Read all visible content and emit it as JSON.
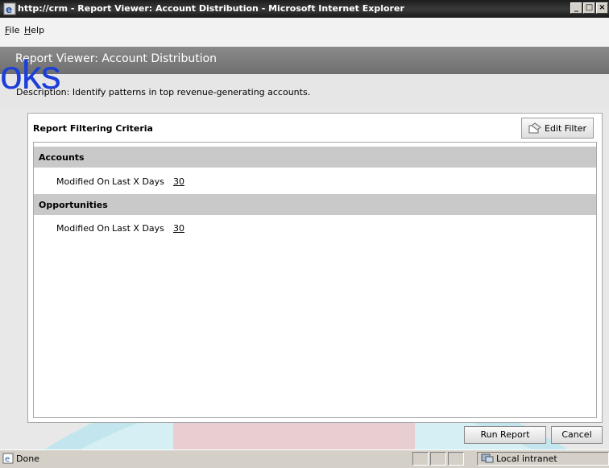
{
  "window": {
    "title": "http://crm - Report Viewer: Account Distribution - Microsoft Internet Explorer",
    "min_label": "_",
    "max_label": "□",
    "close_label": "×"
  },
  "menu": {
    "file_label": "File",
    "file_key": "F",
    "file_rest": "ile",
    "help_label": "Help",
    "help_key": "H",
    "help_rest": "elp"
  },
  "watermark_text": "oks",
  "header": {
    "title": "Report Viewer: Account Distribution",
    "description": "Description: Identify patterns in top revenue-generating accounts."
  },
  "panel": {
    "criteria_title": "Report Filtering Criteria",
    "edit_filter_label": "Edit Filter",
    "sections": [
      {
        "name": "Accounts",
        "rows": [
          {
            "field": "Modified On",
            "operator": "Last X Days",
            "value": "30"
          }
        ]
      },
      {
        "name": "Opportunities",
        "rows": [
          {
            "field": "Modified On",
            "operator": "Last X Days",
            "value": "30"
          }
        ]
      }
    ]
  },
  "buttons": {
    "run_report": "Run Report",
    "cancel": "Cancel"
  },
  "statusbar": {
    "status": "Done",
    "zone": "Local intranet"
  },
  "colors": {
    "header_bg": "#7a7a7a",
    "section_bg": "#c9c9c9",
    "watermark": "#1c3fd9"
  }
}
